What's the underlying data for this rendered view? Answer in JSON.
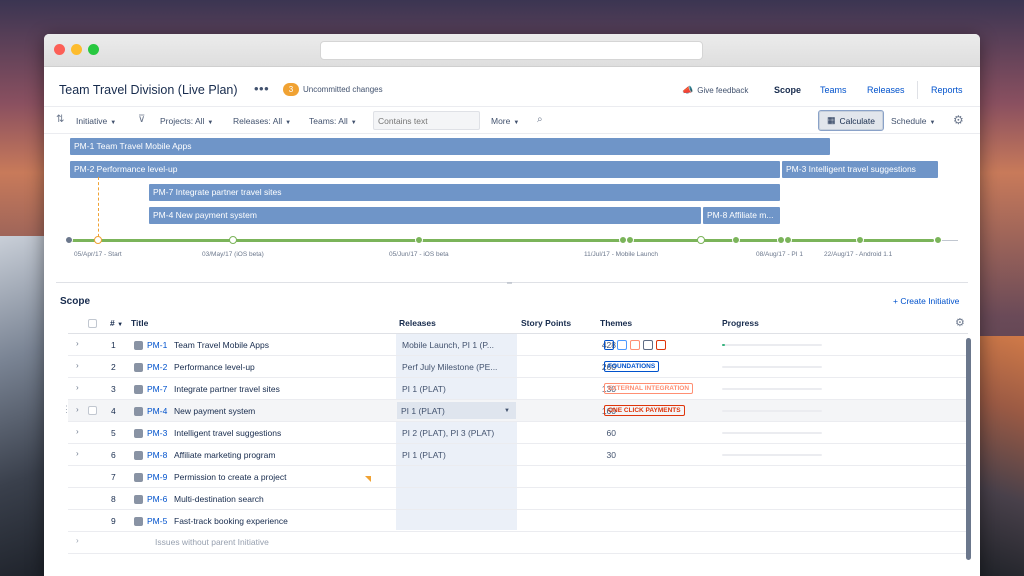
{
  "header": {
    "title": "Team Travel Division (Live Plan)",
    "more": "•••",
    "uncommitted_count": "3",
    "uncommitted_label": "Uncommitted changes",
    "feedback": "Give feedback",
    "nav": [
      "Scope",
      "Teams",
      "Releases",
      "Reports"
    ],
    "active_nav": "Scope"
  },
  "toolbar": {
    "initiative": "Initiative",
    "projects": "Projects: All",
    "releases": "Releases: All",
    "teams": "Teams: All",
    "search_placeholder": "Contains text",
    "more": "More",
    "calculate": "Calculate",
    "schedule": "Schedule"
  },
  "timeline": {
    "bars": [
      {
        "label": "PM-1 Team Travel Mobile Apps"
      },
      {
        "label": "PM-2 Performance level-up"
      },
      {
        "label": "PM-3 Intelligent travel suggestions"
      },
      {
        "label": "PM-7 Integrate partner travel sites"
      },
      {
        "label": "PM-4 New payment system"
      },
      {
        "label": "PM-8 Affiliate m..."
      }
    ],
    "release_labels": [
      "05/Apr/17 - Start",
      "03/May/17 (iOS beta)",
      "05/Jun/17 - iOS beta",
      "11/Jul/17 - Mobile Launch",
      "08/Aug/17 - PI 1",
      "22/Aug/17 - Android 1.1"
    ]
  },
  "scope": {
    "title": "Scope",
    "create_initiative": "+ Create Initiative",
    "columns": {
      "hash": "#",
      "title": "Title",
      "releases": "Releases",
      "story_points": "Story Points",
      "themes": "Themes",
      "progress": "Progress"
    },
    "rows": [
      {
        "num": "1",
        "key": "PM-1",
        "title": "Team Travel Mobile Apps",
        "releases": "Mobile Launch, PI 1 (P...",
        "story_points": "428",
        "progress": 0.03
      },
      {
        "num": "2",
        "key": "PM-2",
        "title": "Performance level-up",
        "releases": "Perf July Milestone (PE...",
        "story_points": "260",
        "theme": "FOUNDATIONS",
        "theme_color": "#0052cc",
        "progress": 0
      },
      {
        "num": "3",
        "key": "PM-7",
        "title": "Integrate partner travel sites",
        "releases": "PI 1 (PLAT)",
        "story_points": "130",
        "theme": "EXTERNAL INTEGRATION",
        "theme_color": "#ff8f73",
        "progress": 0
      },
      {
        "num": "4",
        "key": "PM-4",
        "title": "New payment system",
        "releases": "PI 1 (PLAT)",
        "story_points": "160",
        "theme": "ONE CLICK PAYMENTS",
        "theme_color": "#de350b",
        "progress": 0
      },
      {
        "num": "5",
        "key": "PM-3",
        "title": "Intelligent travel suggestions",
        "releases": "PI 2 (PLAT), PI 3 (PLAT)",
        "story_points": "60",
        "progress": 0
      },
      {
        "num": "6",
        "key": "PM-8",
        "title": "Affiliate marketing program",
        "releases": "PI 1 (PLAT)",
        "story_points": "30",
        "progress": 0
      },
      {
        "num": "7",
        "key": "PM-9",
        "title": "Permission to create a project"
      },
      {
        "num": "8",
        "key": "PM-6",
        "title": "Multi-destination search"
      },
      {
        "num": "9",
        "key": "PM-5",
        "title": "Fast-track booking experience"
      }
    ],
    "footer": "Issues without parent Initiative"
  },
  "colors": {
    "bar": "#6f95c8",
    "axis": "#7bb45a",
    "accent": "#0052cc",
    "badge": "#f0a233"
  }
}
